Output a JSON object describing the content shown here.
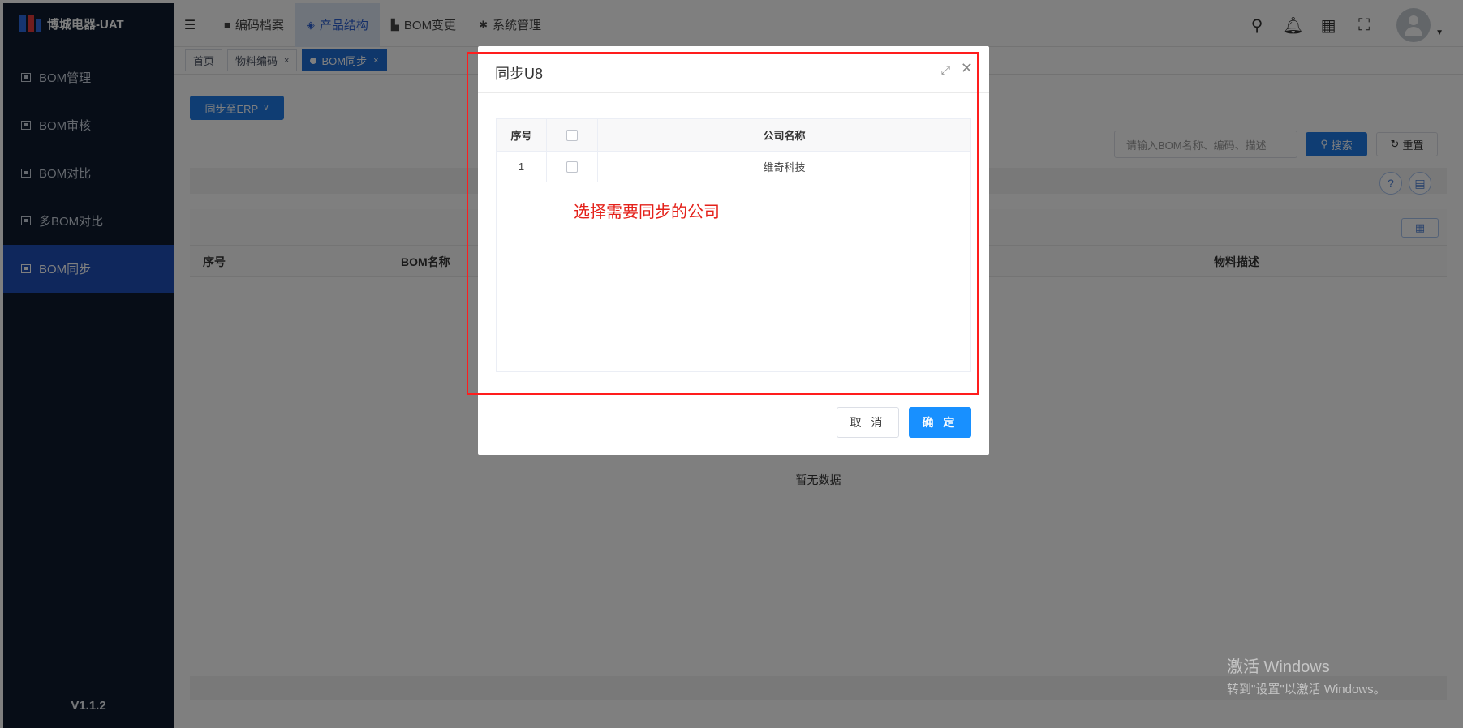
{
  "app": {
    "title": "博城电器-UAT",
    "version": "V1.1.2"
  },
  "sidebar": {
    "items": [
      {
        "label": "BOM管理",
        "active": false
      },
      {
        "label": "BOM审核",
        "active": false
      },
      {
        "label": "BOM对比",
        "active": false
      },
      {
        "label": "多BOM对比",
        "active": false
      },
      {
        "label": "BOM同步",
        "active": true
      }
    ]
  },
  "header": {
    "tabs": [
      {
        "label": "编码档案",
        "icon": "folder-icon",
        "active": false
      },
      {
        "label": "产品结构",
        "icon": "layers-icon",
        "active": true
      },
      {
        "label": "BOM变更",
        "icon": "chart-icon",
        "active": false
      },
      {
        "label": "系统管理",
        "icon": "gear-icon",
        "active": false
      }
    ],
    "icons": [
      "search-icon",
      "bell-icon",
      "qr-icon",
      "fullscreen-icon",
      "avatar"
    ]
  },
  "tags": [
    {
      "label": "首页",
      "active": false,
      "closable": false
    },
    {
      "label": "物料编码",
      "active": false,
      "closable": true
    },
    {
      "label": "BOM同步",
      "active": true,
      "closable": true
    }
  ],
  "tag_close": "×",
  "main": {
    "erp_button": "同步至ERP",
    "search_placeholder": "请输入BOM名称、编码、描述",
    "search_button": "搜索",
    "reset_button": "重置",
    "help_icon": "?",
    "table_headers": {
      "index": "序号",
      "bom_name": "BOM名称",
      "material_desc": "物料描述"
    },
    "empty_text": "暂无数据"
  },
  "dialog": {
    "title": "同步U8",
    "headers": {
      "index": "序号",
      "company": "公司名称"
    },
    "rows": [
      {
        "index": "1",
        "company": "维奇科技"
      }
    ],
    "annotation": "选择需要同步的公司",
    "cancel": "取 消",
    "confirm": "确 定"
  },
  "watermark": {
    "line1": "激活 Windows",
    "line2": "转到\"设置\"以激活 Windows。"
  },
  "colors": {
    "sidebar_bg": "#0e1a2e",
    "sidebar_active": "#1f4fb8",
    "primary": "#1890ff",
    "annotation": "#e4211a"
  }
}
